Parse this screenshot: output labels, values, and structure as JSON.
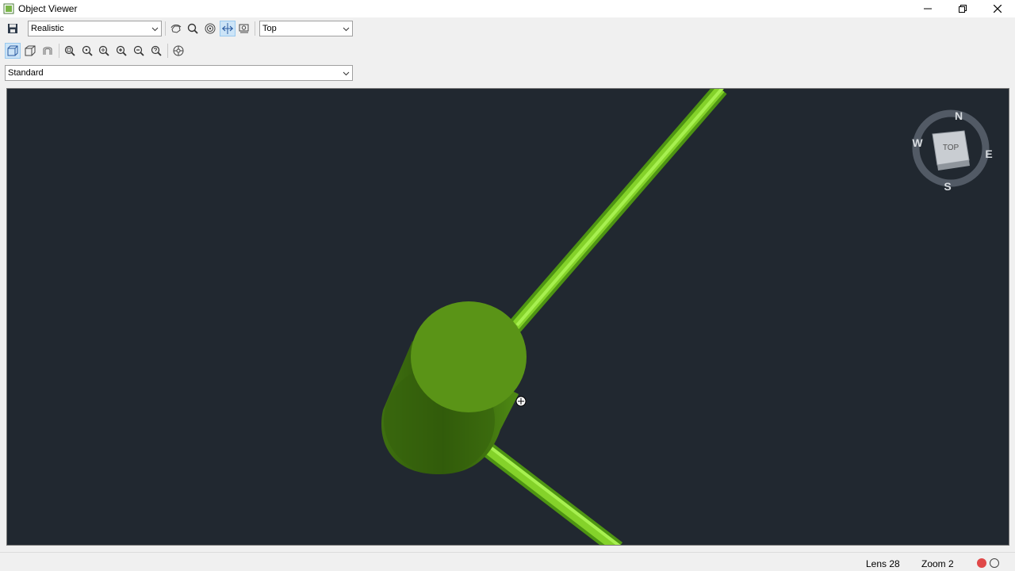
{
  "window": {
    "title": "Object Viewer"
  },
  "toolbar": {
    "visual_style": "Realistic",
    "view": "Top",
    "ucs": "Standard"
  },
  "viewcube": {
    "face": "TOP",
    "north": "N",
    "south": "S",
    "east": "E",
    "west": "W"
  },
  "status": {
    "lens": "Lens 28",
    "zoom": "Zoom 2"
  },
  "colors": {
    "viewport_bg": "#212830",
    "object_green": "#5a9417",
    "pipe_green": "#7ed321",
    "status_red": "#e04848"
  }
}
